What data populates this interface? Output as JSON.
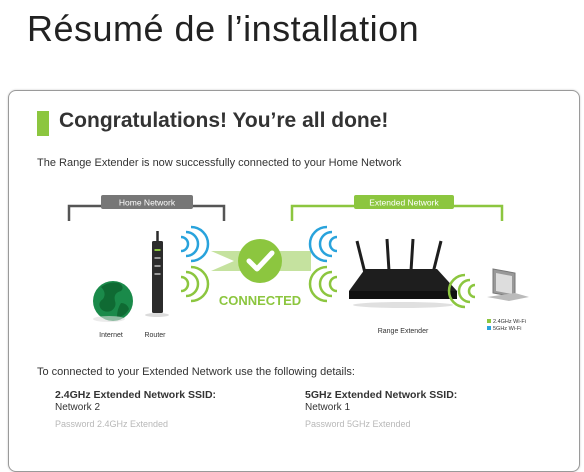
{
  "page": {
    "title": "Résumé de l’installation"
  },
  "panel": {
    "heading": "Congratulations! You’re all done!",
    "subtext": "The Range Extender is now successfully connected to your Home Network",
    "details_text": "To connected to your Extended Network use the following details:"
  },
  "diagram": {
    "home_network_label": "Home Network",
    "extended_network_label": "Extended Network",
    "connected_label": "CONNECTED",
    "internet_label": "Internet",
    "router_label": "Router",
    "range_extender_label": "Range Extender",
    "legend": [
      {
        "label": "2.4GHz Wi-Fi",
        "color": "#8cc63f"
      },
      {
        "label": "5GHz Wi-Fi",
        "color": "#29a3dc"
      }
    ]
  },
  "ssids": [
    {
      "label": "2.4GHz Extended Network SSID:",
      "value": "Network 2",
      "faded": "Password 2.4GHz Extended"
    },
    {
      "label": "5GHz Extended Network SSID:",
      "value": "Network 1",
      "faded": "Password 5GHz Extended"
    }
  ],
  "colors": {
    "accent": "#8cc63f",
    "wifi_blue": "#29a3dc",
    "grey_tab": "#777777"
  }
}
